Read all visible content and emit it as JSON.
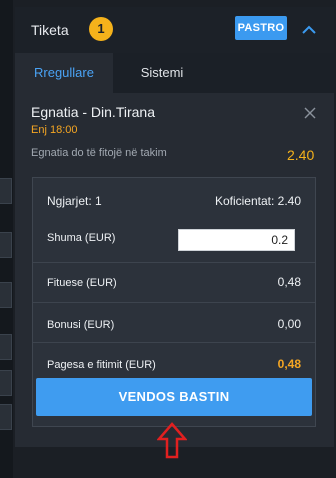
{
  "betslip": {
    "title": "Tiketa",
    "count": "1",
    "clear_label": "PASTRO",
    "tabs": [
      "Rregullare",
      "Sistemi"
    ],
    "selection": {
      "event": "Egnatia - Din.Tirana",
      "time": "Enj 18:00",
      "market": "Egnatia do të fitojë në takim",
      "odds": "2.40"
    },
    "summary": {
      "events_label": "Ngjarjet: 1",
      "coef_label": "Koficientat: 2.40",
      "stake_label": "Shuma (EUR)",
      "stake_value": "0.2",
      "win_label": "Fituese (EUR)",
      "win_value": "0,48",
      "bonus_label": "Bonusi (EUR)",
      "bonus_value": "0,00",
      "payout_label": "Pagesa e fitimit (EUR)",
      "payout_value": "0,48"
    },
    "place_bet_label": "VENDOS BASTIN"
  },
  "colors": {
    "accent": "#3b9af0",
    "badge": "#f5b21b",
    "highlight": "#f5a623",
    "annotation_arrow": "#e02020"
  },
  "icons": {
    "collapse": "chevron-up-icon",
    "remove": "close-icon",
    "annotation": "red-up-arrow"
  }
}
